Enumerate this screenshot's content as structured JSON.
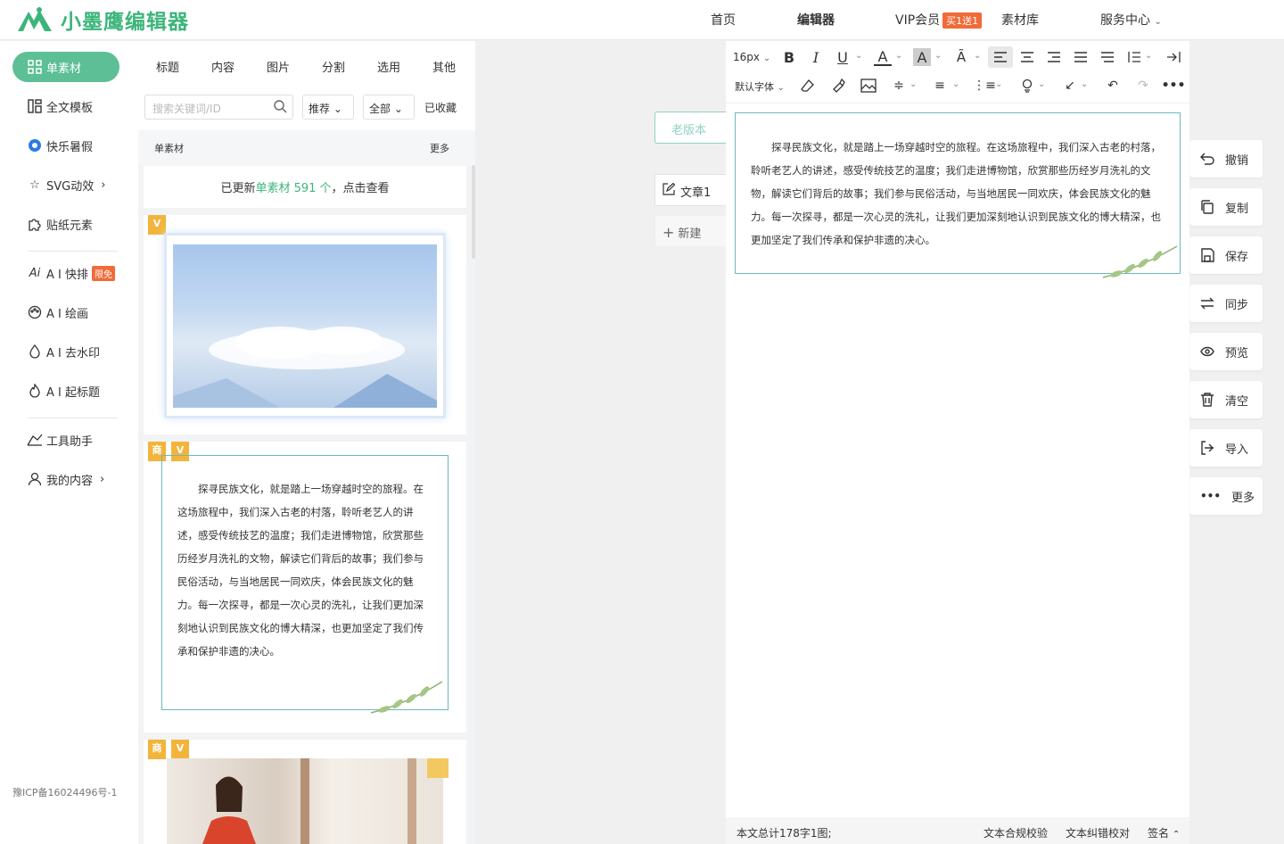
{
  "app": {
    "logo_text": "小墨鹰编辑器"
  },
  "nav": {
    "home": "首页",
    "editor": "编辑器",
    "vip": "VIP会员",
    "vip_badge": "买1送1",
    "library": "素材库",
    "service": "服务中心"
  },
  "sidebar": {
    "items": [
      {
        "label": "单素材",
        "icon": "grid-icon"
      },
      {
        "label": "全文模板",
        "icon": "template-icon"
      },
      {
        "label": "快乐暑假",
        "icon": "football-icon"
      },
      {
        "label": "SVG动效",
        "icon": "star-icon"
      },
      {
        "label": "贴纸元素",
        "icon": "puzzle-icon"
      },
      {
        "label": "A I 快排",
        "icon": "ai-icon",
        "badge": "限免"
      },
      {
        "label": "A I 绘画",
        "icon": "palette-icon"
      },
      {
        "label": "A I 去水印",
        "icon": "drop-icon"
      },
      {
        "label": "A I 起标题",
        "icon": "fire-icon"
      },
      {
        "label": "工具助手",
        "icon": "tools-icon"
      },
      {
        "label": "我的内容",
        "icon": "user-icon"
      }
    ],
    "icp": "豫ICP备16024496号-1"
  },
  "material": {
    "tabs": [
      "标题",
      "内容",
      "图片",
      "分割",
      "选用",
      "其他"
    ],
    "search_placeholder": "搜索关键词/ID",
    "filter_recommend": "推荐",
    "filter_all": "全部",
    "favorites": "已收藏",
    "section_title": "单素材",
    "section_more": "更多",
    "update_prefix": "已更新",
    "update_highlight": "单素材 591 个",
    "update_suffix": "，点击查看",
    "tag_v": "V",
    "tag_shang": "商",
    "sample_text": "探寻民族文化，就是踏上一场穿越时空的旅程。在这场旅程中，我们深入古老的村落，聆听老艺人的讲述，感受传统技艺的温度；我们走进博物馆，欣赏那些历经岁月洗礼的文物，解读它们背后的故事；我们参与民俗活动，与当地居民一同欢庆，体会民族文化的魅力。每一次探寻，都是一次心灵的洗礼，让我们更加深刻地认识到民族文化的博大精深，也更加坚定了我们传承和保护非遗的决心。"
  },
  "articles": {
    "old_version": "老版本",
    "article1": "文章1",
    "new": "新建"
  },
  "toolbar": {
    "font_size": "16px",
    "default_font": "默认字体"
  },
  "editor": {
    "text": "探寻民族文化，就是踏上一场穿越时空的旅程。在这场旅程中，我们深入古老的村落，聆听老艺人的讲述，感受传统技艺的温度；我们走进博物馆，欣赏那些历经岁月洗礼的文物，解读它们背后的故事；我们参与民俗活动，与当地居民一同欢庆，体会民族文化的魅力。每一次探寻，都是一次心灵的洗礼，让我们更加深刻地认识到民族文化的博大精深，也更加坚定了我们传承和保护非遗的决心。"
  },
  "footer": {
    "stats": "本文总计178字1图;",
    "compliance": "文本合规校验",
    "proofread": "文本纠错校对",
    "signature": "签名"
  },
  "actions": [
    "撤销",
    "复制",
    "保存",
    "同步",
    "预览",
    "清空",
    "导入",
    "更多"
  ],
  "colors": {
    "accent": "#5dbf95",
    "brand": "#3cb57b",
    "badge": "#f16a37",
    "tag": "#f3b43c"
  }
}
